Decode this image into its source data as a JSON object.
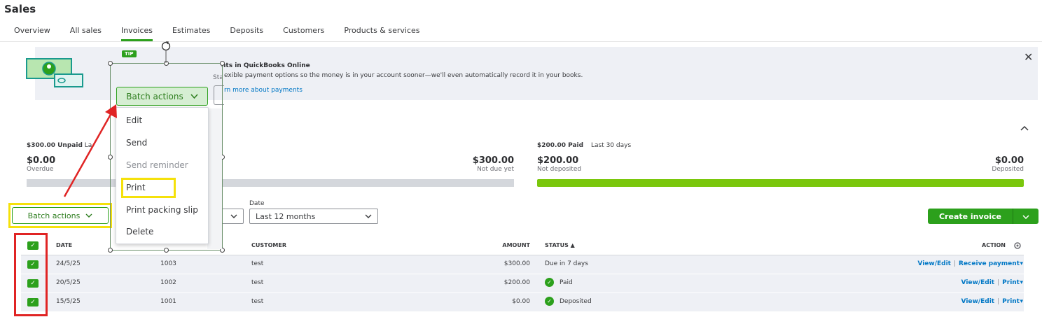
{
  "page": {
    "title": "Sales"
  },
  "tabs": [
    {
      "label": "Overview"
    },
    {
      "label": "All sales"
    },
    {
      "label": "Invoices"
    },
    {
      "label": "Estimates"
    },
    {
      "label": "Deposits"
    },
    {
      "label": "Customers"
    },
    {
      "label": "Products & services"
    }
  ],
  "tip": {
    "badge": "TIP",
    "title": "nts in QuickBooks Online",
    "body": "exible payment options so the money is in your account sooner—we'll even automatically record it in your books.",
    "start": "Sta",
    "link": "rn more about payments",
    "close": "✕"
  },
  "summary": {
    "unpaid": {
      "label": "$300.00 Unpaid",
      "period": "La"
    },
    "overdue": {
      "amount": "$0.00",
      "label": "Overdue"
    },
    "not_due": {
      "amount": "$300.00",
      "label": "Not due yet"
    },
    "paid": {
      "label": "$200.00 Paid",
      "period": "Last 30 days"
    },
    "not_deposited": {
      "amount": "$200.00",
      "label": "Not deposited"
    },
    "deposited": {
      "amount": "$0.00",
      "label": "Deposited"
    },
    "collapse": "^"
  },
  "toolbar": {
    "batch_label": "Batch actions",
    "date_label": "Date",
    "date_value": "Last 12 months",
    "create_label": "Create invoice"
  },
  "table": {
    "headers": {
      "date": "DATE",
      "customer": "CUSTOMER",
      "amount": "AMOUNT",
      "status": "STATUS ▲",
      "action": "ACTION"
    },
    "rows": [
      {
        "date": "24/5/25",
        "no": "1003",
        "customer": "test",
        "amount": "$300.00",
        "status": "Due in 7 days",
        "action1": "View/Edit",
        "action2": "Receive payment"
      },
      {
        "date": "20/5/25",
        "no": "1002",
        "customer": "test",
        "amount": "$200.00",
        "status": "Paid",
        "action1": "View/Edit",
        "action2": "Print"
      },
      {
        "date": "15/5/25",
        "no": "1001",
        "customer": "test",
        "amount": "$0.00",
        "status": "Deposited",
        "action1": "View/Edit",
        "action2": "Print"
      }
    ]
  },
  "menu": {
    "button": "Batch actions",
    "items": [
      {
        "label": "Edit"
      },
      {
        "label": "Send"
      },
      {
        "label": "Send reminder"
      },
      {
        "label": "Print"
      },
      {
        "label": "Print packing slip"
      },
      {
        "label": "Delete"
      }
    ]
  },
  "colors": {
    "accent": "#2ca01c",
    "link": "#0077c5",
    "highlight_yellow": "#f5e10b",
    "highlight_red": "#e02424"
  }
}
